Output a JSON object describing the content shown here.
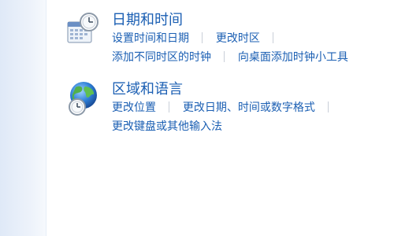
{
  "sections": [
    {
      "title": "日期和时间",
      "icon": "calendar-clock-icon",
      "links": {
        "set_time_date": "设置时间和日期",
        "change_timezone": "更改时区",
        "add_clocks": "添加不同时区的时钟",
        "add_gadget": "向桌面添加时钟小工具"
      }
    },
    {
      "title": "区域和语言",
      "icon": "globe-clock-icon",
      "links": {
        "change_location": "更改位置",
        "change_formats": "更改日期、时间或数字格式",
        "change_keyboard": "更改键盘或其他输入法"
      }
    }
  ],
  "colors": {
    "title": "#1f6f3a",
    "link": "#1b5fb3",
    "separator": "#c9cfd8"
  }
}
